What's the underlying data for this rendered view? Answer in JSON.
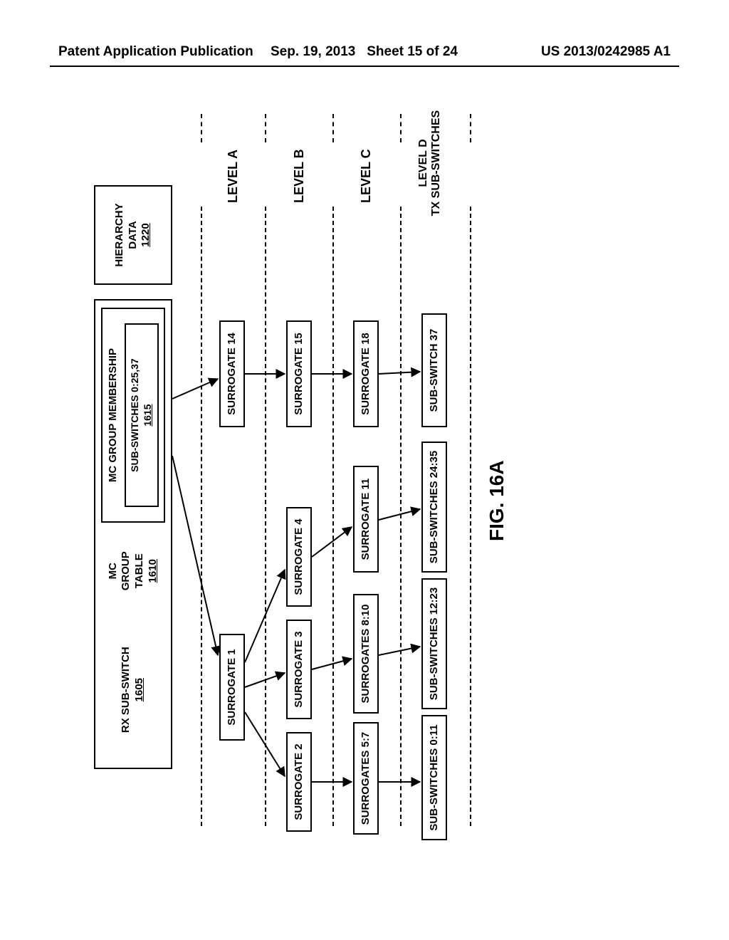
{
  "doc_header": {
    "left": "Patent Application Publication",
    "date": "Sep. 19, 2013",
    "sheet": "Sheet 15 of 24",
    "pubno": "US 2013/0242985 A1"
  },
  "figure_caption": "FIG. 16A",
  "levels": {
    "a": "LEVEL A",
    "b": "LEVEL B",
    "c": "LEVEL C",
    "d1": "LEVEL D",
    "d2": "TX SUB-SWITCHES"
  },
  "top": {
    "rx": {
      "line1": "RX SUB-SWITCH",
      "line2": "1605"
    },
    "mcgt": {
      "line1": "MC",
      "line2": "GROUP",
      "line3": "TABLE",
      "line4": "1610"
    },
    "membership_title": "MC GROUP MEMBERSHIP",
    "membership_sub": {
      "line1": "SUB-SWITCHES 0:25,37",
      "line2": "1615"
    },
    "hier": {
      "line1": "HIERARCHY",
      "line2": "DATA",
      "line3": "1220"
    }
  },
  "nodes": {
    "s1": "SURROGATE 1",
    "s14": "SURROGATE 14",
    "s2": "SURROGATE 2",
    "s3": "SURROGATE 3",
    "s4": "SURROGATE 4",
    "s15": "SURROGATE 15",
    "ss57": "SURROGATES 5:7",
    "ss810": "SURROGATES 8:10",
    "s11": "SURROGATE 11",
    "s18": "SURROGATE 18",
    "sw011": "SUB-SWITCHES 0:11",
    "sw1223": "SUB-SWITCHES 12:23",
    "sw2435": "SUB-SWITCHES 24:35",
    "sw37": "SUB-SWITCH 37"
  }
}
